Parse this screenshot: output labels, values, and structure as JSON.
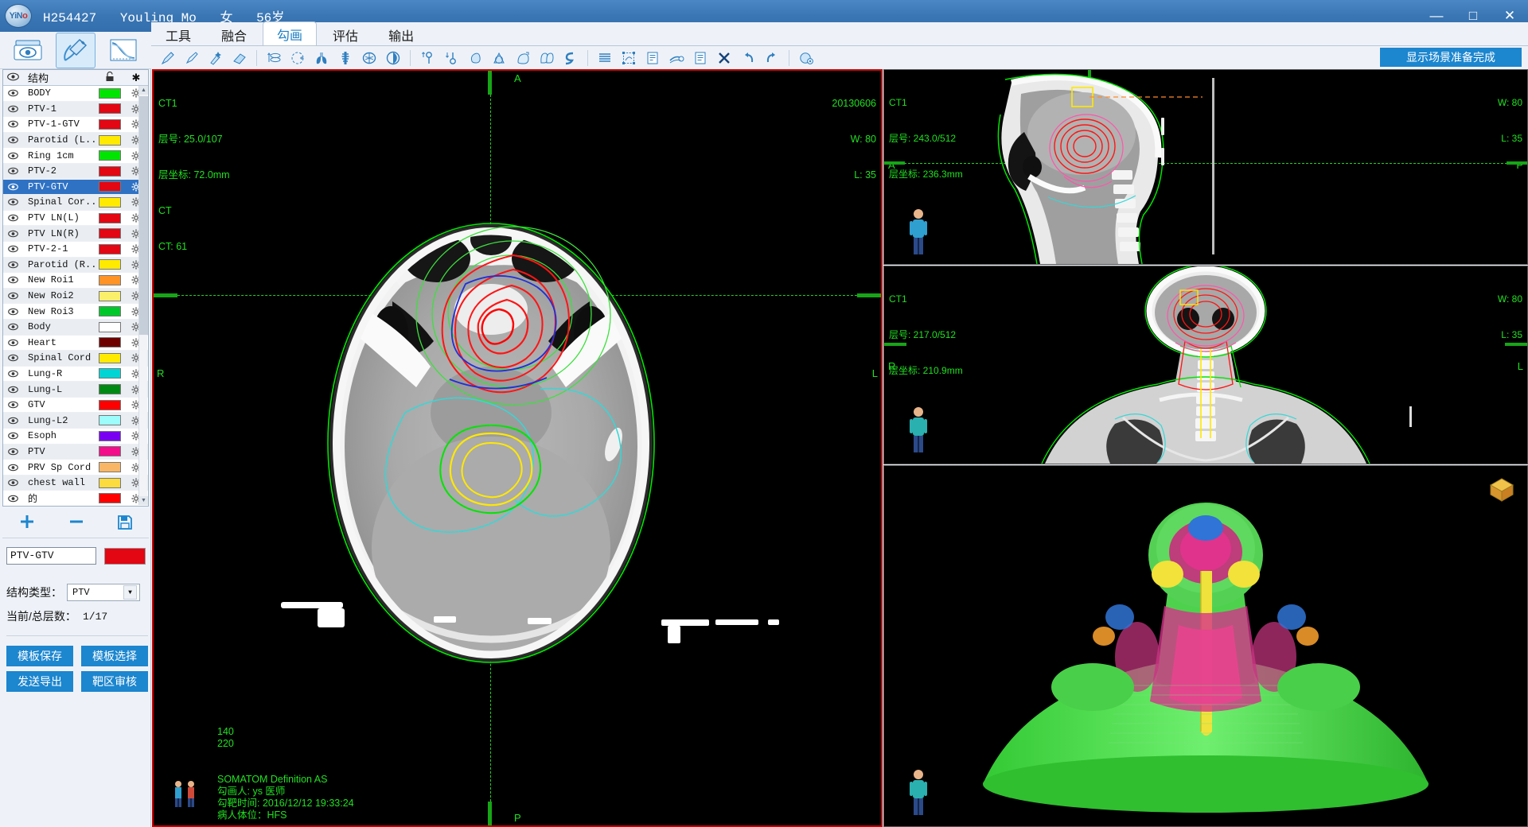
{
  "titlebar": {
    "logo_text": "YiN",
    "logo_accent": "o",
    "patient_id": "H254427",
    "patient_name": "Youling Mo",
    "patient_sex": "女",
    "patient_age": "56岁",
    "minimize": "—",
    "maximize": "□",
    "close": "✕"
  },
  "modebar": {
    "buttons": [
      {
        "name": "image-browser-icon",
        "title": "影像浏览"
      },
      {
        "name": "contouring-icon",
        "title": "勾画"
      },
      {
        "name": "dvh-curve-icon",
        "title": "曲线"
      }
    ]
  },
  "ribbon": {
    "tabs": [
      {
        "label": "工具",
        "active": false
      },
      {
        "label": "融合",
        "active": false
      },
      {
        "label": "勾画",
        "active": true
      },
      {
        "label": "评估",
        "active": false
      },
      {
        "label": "输出",
        "active": false
      }
    ],
    "status_label": "显示场景准备完成",
    "status_color": "#1c86cf",
    "tools": [
      {
        "name": "pen-tool-icon"
      },
      {
        "name": "brush-tool-icon"
      },
      {
        "name": "magic-wand-tool-icon"
      },
      {
        "name": "eraser-tool-icon"
      },
      {
        "sep": true
      },
      {
        "name": "interpolate-slices-icon"
      },
      {
        "name": "circle-region-icon"
      },
      {
        "name": "auto-lung-segment-icon"
      },
      {
        "name": "auto-spine-segment-icon"
      },
      {
        "name": "auto-brain-segment-icon"
      },
      {
        "name": "auto-organ-segment-icon"
      },
      {
        "sep": true
      },
      {
        "name": "expand-margin-icon"
      },
      {
        "name": "shrink-margin-icon"
      },
      {
        "name": "boolean-union-icon"
      },
      {
        "name": "boolean-intersect-icon"
      },
      {
        "name": "boolean-subtract-icon"
      },
      {
        "name": "copy-structure-icon"
      },
      {
        "name": "smooth-contour-icon"
      },
      {
        "sep": true
      },
      {
        "name": "fill-contour-icon"
      },
      {
        "name": "crop-contour-icon"
      },
      {
        "name": "structure-list-icon"
      },
      {
        "name": "measure-icon"
      },
      {
        "name": "report-icon"
      },
      {
        "name": "delete-structure-icon"
      },
      {
        "name": "undo-icon"
      },
      {
        "name": "redo-icon"
      },
      {
        "sep": true
      },
      {
        "name": "settings-icon"
      }
    ]
  },
  "sidebar": {
    "header": {
      "eye": "👁",
      "name": "结构",
      "lock": "🔓",
      "gear": "✱"
    },
    "structures": [
      {
        "label": "BODY",
        "color": "#00e500",
        "selected": false
      },
      {
        "label": "PTV-1",
        "color": "#e30613",
        "selected": false
      },
      {
        "label": "PTV-1-GTV",
        "color": "#e30613",
        "selected": false
      },
      {
        "label": "Parotid (L...",
        "color": "#ffea00",
        "selected": false
      },
      {
        "label": "Ring 1cm",
        "color": "#00e500",
        "selected": false
      },
      {
        "label": "PTV-2",
        "color": "#e30613",
        "selected": false
      },
      {
        "label": "PTV-GTV",
        "color": "#e30613",
        "selected": true
      },
      {
        "label": "Spinal Cor...",
        "color": "#ffea00",
        "selected": false
      },
      {
        "label": "PTV LN(L)",
        "color": "#e30613",
        "selected": false
      },
      {
        "label": "PTV LN(R)",
        "color": "#e30613",
        "selected": false
      },
      {
        "label": "PTV-2-1",
        "color": "#e30613",
        "selected": false
      },
      {
        "label": "Parotid (R...",
        "color": "#ffea00",
        "selected": false
      },
      {
        "label": "New Roi1",
        "color": "#ff9326",
        "selected": false
      },
      {
        "label": "New Roi2",
        "color": "#fbf06a",
        "selected": false
      },
      {
        "label": "New Roi3",
        "color": "#00c82a",
        "selected": false
      },
      {
        "label": "Body",
        "color": "#ffffff",
        "selected": false
      },
      {
        "label": "Heart",
        "color": "#6e0000",
        "selected": false
      },
      {
        "label": "Spinal Cord",
        "color": "#ffea00",
        "selected": false
      },
      {
        "label": "Lung-R",
        "color": "#00d5d5",
        "selected": false
      },
      {
        "label": "Lung-L",
        "color": "#008a13",
        "selected": false
      },
      {
        "label": "GTV",
        "color": "#ff0000",
        "selected": false
      },
      {
        "label": "Lung-L2",
        "color": "#9dfcfc",
        "selected": false
      },
      {
        "label": "Esoph",
        "color": "#7a00f2",
        "selected": false
      },
      {
        "label": "PTV",
        "color": "#f40d8a",
        "selected": false
      },
      {
        "label": "PRV Sp Cord",
        "color": "#f9b765",
        "selected": false
      },
      {
        "label": "chest wall",
        "color": "#fcdb3e",
        "selected": false
      },
      {
        "label": "的",
        "color": "#ff0000",
        "selected": false
      }
    ],
    "actions": [
      {
        "name": "add-structure-button",
        "glyph": "＋"
      },
      {
        "name": "remove-structure-button",
        "glyph": "－"
      },
      {
        "name": "save-structure-button",
        "glyph": "💾"
      }
    ],
    "name_field": {
      "value": "PTV-GTV",
      "color": "#e30613"
    },
    "type_row": {
      "label": "结构类型：",
      "value": "PTV"
    },
    "slice_row": {
      "label": "当前/总层数：",
      "value": "1/17"
    },
    "buttons": [
      {
        "label": "模板保存",
        "name": "save-template-button"
      },
      {
        "label": "模板选择",
        "name": "select-template-button"
      },
      {
        "label": "发送导出",
        "name": "send-export-button"
      },
      {
        "label": "靶区审核",
        "name": "target-review-button"
      }
    ]
  },
  "viewports": {
    "axial": {
      "series": "CT1",
      "slice_line": "层号: 25.0/107",
      "coord_line": "层坐标: 72.0mm",
      "modality": "CT",
      "ct_value": "CT: 61",
      "date": "20130606",
      "window": "W: 80",
      "level": "L: 35",
      "orient_top": "A",
      "orient_bottom": "P",
      "orient_left": "R",
      "orient_right": "L",
      "scale_top": "140",
      "scale_bottom": "220",
      "info": [
        "SOMATOM Definition AS",
        "勾画人: ys 医师",
        "勾靶时间: 2016/12/12 19:33:24",
        "病人体位：HFS"
      ]
    },
    "sagittal": {
      "series": "CT1",
      "slice_line": "层号: 243.0/512",
      "coord_line": "层坐标: 236.3mm",
      "window": "W: 80",
      "level": "L: 35",
      "orient_left": "A",
      "orient_right": "P"
    },
    "coronal": {
      "series": "CT1",
      "slice_line": "层号: 217.0/512",
      "coord_line": "层坐标: 210.9mm",
      "window": "W: 80",
      "level": "L: 35",
      "orient_left": "R",
      "orient_right": "L"
    },
    "threed": {
      "cube_icon": "orientation-cube-icon"
    }
  },
  "colors": {
    "accent": "#1c86cf",
    "title_bar": "#3a76b4",
    "selection": "#2f72c4",
    "overlay_green": "#20e020",
    "active_border": "#cc0000"
  }
}
